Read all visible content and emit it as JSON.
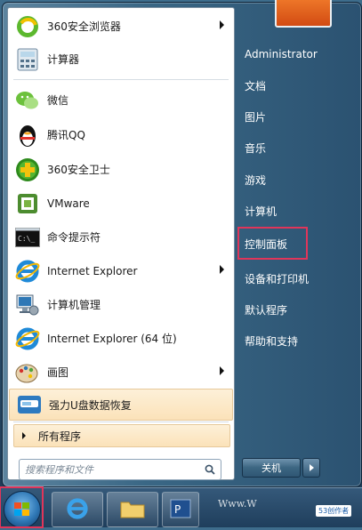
{
  "programs": [
    {
      "label": "360安全浏览器",
      "icon": "360-browser-icon",
      "has_submenu": true
    },
    {
      "label": "计算器",
      "icon": "calculator-icon",
      "has_submenu": false
    },
    {
      "label": "微信",
      "icon": "wechat-icon",
      "has_submenu": false
    },
    {
      "label": "腾讯QQ",
      "icon": "qq-penguin-icon",
      "has_submenu": false
    },
    {
      "label": "360安全卫士",
      "icon": "360-safeguard-icon",
      "has_submenu": false
    },
    {
      "label": "VMware",
      "icon": "vmware-icon",
      "has_submenu": false
    },
    {
      "label": "命令提示符",
      "icon": "cmd-icon",
      "has_submenu": false
    },
    {
      "label": "Internet Explorer",
      "icon": "ie-icon",
      "has_submenu": true
    },
    {
      "label": "计算机管理",
      "icon": "computer-management-icon",
      "has_submenu": false
    },
    {
      "label": "Internet Explorer (64 位)",
      "icon": "ie-icon",
      "has_submenu": false
    },
    {
      "label": "画图",
      "icon": "paint-icon",
      "has_submenu": true
    },
    {
      "label": "强力U盘数据恢复",
      "icon": "usb-recovery-icon",
      "has_submenu": false,
      "highlighted": true
    }
  ],
  "all_programs_label": "所有程序",
  "search_placeholder": "搜索程序和文件",
  "right_items": [
    {
      "label": "Administrator"
    },
    {
      "label": "文档"
    },
    {
      "label": "图片"
    },
    {
      "label": "音乐"
    },
    {
      "label": "游戏"
    },
    {
      "label": "计算机"
    },
    {
      "label": "控制面板",
      "boxed": true
    },
    {
      "label": "设备和打印机"
    },
    {
      "label": "默认程序"
    },
    {
      "label": "帮助和支持"
    }
  ],
  "shutdown_label": "关机",
  "watermark": "Www.W",
  "watermark_badge": "53创作者",
  "accent": {
    "highlight": "#fbe2b9",
    "box": "#e0355a"
  }
}
